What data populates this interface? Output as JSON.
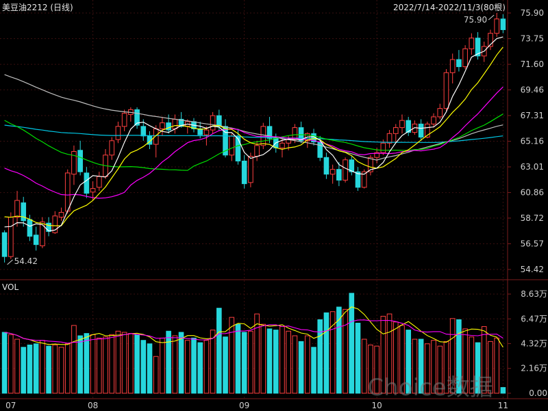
{
  "chart_data": {
    "type": "candlestick",
    "title": "美豆油2212 (日线)",
    "range_text": "2022/7/14-2022/11/3(80根)",
    "price_axis": {
      "ticks": [
        "75.90",
        "73.75",
        "71.60",
        "69.46",
        "67.31",
        "65.16",
        "63.01",
        "60.86",
        "58.72",
        "56.57",
        "54.42"
      ],
      "ylim": [
        54.42,
        75.9
      ]
    },
    "volume_panel": {
      "label": "VOL",
      "ticks": [
        "8.63万",
        "6.47万",
        "4.32万",
        "2.16万",
        "0.00"
      ],
      "ylim": [
        0,
        8.63
      ]
    },
    "x_ticks": [
      {
        "label": "07",
        "index": 1
      },
      {
        "label": "08",
        "index": 14
      },
      {
        "label": "09",
        "index": 38
      },
      {
        "label": "10",
        "index": 59
      },
      {
        "label": "11",
        "index": 79
      }
    ],
    "annotations": {
      "high": "75.90",
      "low": "54.42"
    },
    "watermark": "Choice数据",
    "colors": {
      "up": "#ff4040",
      "down": "#27d7dc",
      "ma5": "#ffffff",
      "ma10": "#ffff00",
      "ma20": "#ff00ff",
      "ma30": "#00e000",
      "ma60": "#c0c0c0",
      "ma120": "#00c8e6",
      "vol_ma5": "#ffff00",
      "vol_ma10": "#ff00ff"
    },
    "candles": [
      [
        57.5,
        57.7,
        55.0,
        55.5
      ],
      [
        55.5,
        59.2,
        55.3,
        58.8
      ],
      [
        58.8,
        61.0,
        58.0,
        60.2
      ],
      [
        60.0,
        60.5,
        58.0,
        58.5
      ],
      [
        58.6,
        59.0,
        56.8,
        57.2
      ],
      [
        57.3,
        58.0,
        56.0,
        56.5
      ],
      [
        56.4,
        58.8,
        56.2,
        58.4
      ],
      [
        58.3,
        58.8,
        57.2,
        57.6
      ],
      [
        57.5,
        59.3,
        57.4,
        58.9
      ],
      [
        58.8,
        59.6,
        58.5,
        59.2
      ],
      [
        59.3,
        62.8,
        59.1,
        62.5
      ],
      [
        62.4,
        64.8,
        61.5,
        64.3
      ],
      [
        64.4,
        65.2,
        62.3,
        62.6
      ],
      [
        62.5,
        63.0,
        60.4,
        60.8
      ],
      [
        60.9,
        61.8,
        60.2,
        61.2
      ],
      [
        61.3,
        62.6,
        61.0,
        62.2
      ],
      [
        62.2,
        64.5,
        62.0,
        64.0
      ],
      [
        64.0,
        65.5,
        63.6,
        65.2
      ],
      [
        65.3,
        66.8,
        65.0,
        66.4
      ],
      [
        66.4,
        67.8,
        66.0,
        67.5
      ],
      [
        67.4,
        68.0,
        66.8,
        67.8
      ],
      [
        67.8,
        68.0,
        66.2,
        66.5
      ],
      [
        66.4,
        67.0,
        65.2,
        65.6
      ],
      [
        65.6,
        66.0,
        64.5,
        64.9
      ],
      [
        64.9,
        66.5,
        63.8,
        66.2
      ],
      [
        66.2,
        67.2,
        65.6,
        66.7
      ],
      [
        66.7,
        67.4,
        65.8,
        66.1
      ],
      [
        66.2,
        67.4,
        65.8,
        67.0
      ],
      [
        67.0,
        67.6,
        66.3,
        66.4
      ],
      [
        66.4,
        67.0,
        65.8,
        66.8
      ],
      [
        66.8,
        67.1,
        65.9,
        66.2
      ],
      [
        66.2,
        66.8,
        65.4,
        65.7
      ],
      [
        65.7,
        66.4,
        64.8,
        66.1
      ],
      [
        66.1,
        67.6,
        65.8,
        67.3
      ],
      [
        67.3,
        67.8,
        66.0,
        66.4
      ],
      [
        66.4,
        67.0,
        63.8,
        64.0
      ],
      [
        64.0,
        65.8,
        63.5,
        65.6
      ],
      [
        65.6,
        66.2,
        63.2,
        63.5
      ],
      [
        63.5,
        64.0,
        61.2,
        61.6
      ],
      [
        61.7,
        64.2,
        61.3,
        63.9
      ],
      [
        63.9,
        65.2,
        63.5,
        64.8
      ],
      [
        64.8,
        66.7,
        64.5,
        66.4
      ],
      [
        66.4,
        67.2,
        65.0,
        65.4
      ],
      [
        65.4,
        65.8,
        64.2,
        64.6
      ],
      [
        64.6,
        65.4,
        63.8,
        65.0
      ],
      [
        65.0,
        65.6,
        64.4,
        65.3
      ],
      [
        65.3,
        66.6,
        65.0,
        66.3
      ],
      [
        66.3,
        66.8,
        65.0,
        65.2
      ],
      [
        65.2,
        65.9,
        64.6,
        65.8
      ],
      [
        65.8,
        66.2,
        64.8,
        65.1
      ],
      [
        65.1,
        65.6,
        63.5,
        63.8
      ],
      [
        63.8,
        64.2,
        62.0,
        62.4
      ],
      [
        62.4,
        63.2,
        61.6,
        62.8
      ],
      [
        62.8,
        63.4,
        61.4,
        61.9
      ],
      [
        61.9,
        63.8,
        61.7,
        63.6
      ],
      [
        63.6,
        63.9,
        62.3,
        62.6
      ],
      [
        62.6,
        63.0,
        61.0,
        61.3
      ],
      [
        61.3,
        62.8,
        61.2,
        62.6
      ],
      [
        62.6,
        64.0,
        62.3,
        63.8
      ],
      [
        63.8,
        64.6,
        63.3,
        64.2
      ],
      [
        64.2,
        65.3,
        64.0,
        65.0
      ],
      [
        65.0,
        66.1,
        64.6,
        65.8
      ],
      [
        65.8,
        66.6,
        65.1,
        66.3
      ],
      [
        66.3,
        67.4,
        65.8,
        66.9
      ],
      [
        66.9,
        67.2,
        65.6,
        65.9
      ],
      [
        65.9,
        66.9,
        65.7,
        66.6
      ],
      [
        66.6,
        67.0,
        65.2,
        65.5
      ],
      [
        65.5,
        66.8,
        65.4,
        66.6
      ],
      [
        66.6,
        67.5,
        66.3,
        67.2
      ],
      [
        67.2,
        68.3,
        67.0,
        67.9
      ],
      [
        67.9,
        71.2,
        67.7,
        70.9
      ],
      [
        70.9,
        72.5,
        70.0,
        72.0
      ],
      [
        72.0,
        72.8,
        71.0,
        71.4
      ],
      [
        71.4,
        73.2,
        71.2,
        72.9
      ],
      [
        72.9,
        74.2,
        72.4,
        73.8
      ],
      [
        73.8,
        74.3,
        72.0,
        72.3
      ],
      [
        72.3,
        73.5,
        71.8,
        73.1
      ],
      [
        73.1,
        74.5,
        72.8,
        74.2
      ],
      [
        74.2,
        75.9,
        73.9,
        75.4
      ],
      [
        75.4,
        75.8,
        74.2,
        74.5
      ]
    ],
    "volume": [
      5.3,
      5.1,
      4.7,
      4.0,
      4.2,
      4.3,
      4.6,
      4.1,
      4.2,
      4.0,
      4.3,
      5.9,
      5.0,
      5.2,
      5.1,
      4.8,
      4.9,
      5.1,
      5.4,
      5.3,
      5.2,
      5.1,
      4.6,
      4.3,
      3.2,
      4.8,
      5.4,
      5.0,
      5.3,
      4.6,
      4.8,
      4.4,
      4.6,
      5.5,
      7.4,
      4.9,
      6.6,
      6.0,
      5.3,
      5.4,
      6.9,
      6.0,
      5.6,
      5.5,
      5.8,
      5.4,
      5.0,
      4.5,
      5.0,
      4.0,
      6.4,
      7.0,
      7.1,
      7.5,
      7.3,
      8.7,
      6.1,
      4.7,
      4.2,
      4.1,
      6.7,
      6.9,
      6.2,
      5.9,
      5.5,
      4.7,
      4.7,
      4.3,
      4.6,
      4.1,
      4.5,
      6.5,
      6.4,
      5.6,
      4.9,
      4.4,
      5.8,
      4.5,
      4.8,
      0.5
    ]
  }
}
